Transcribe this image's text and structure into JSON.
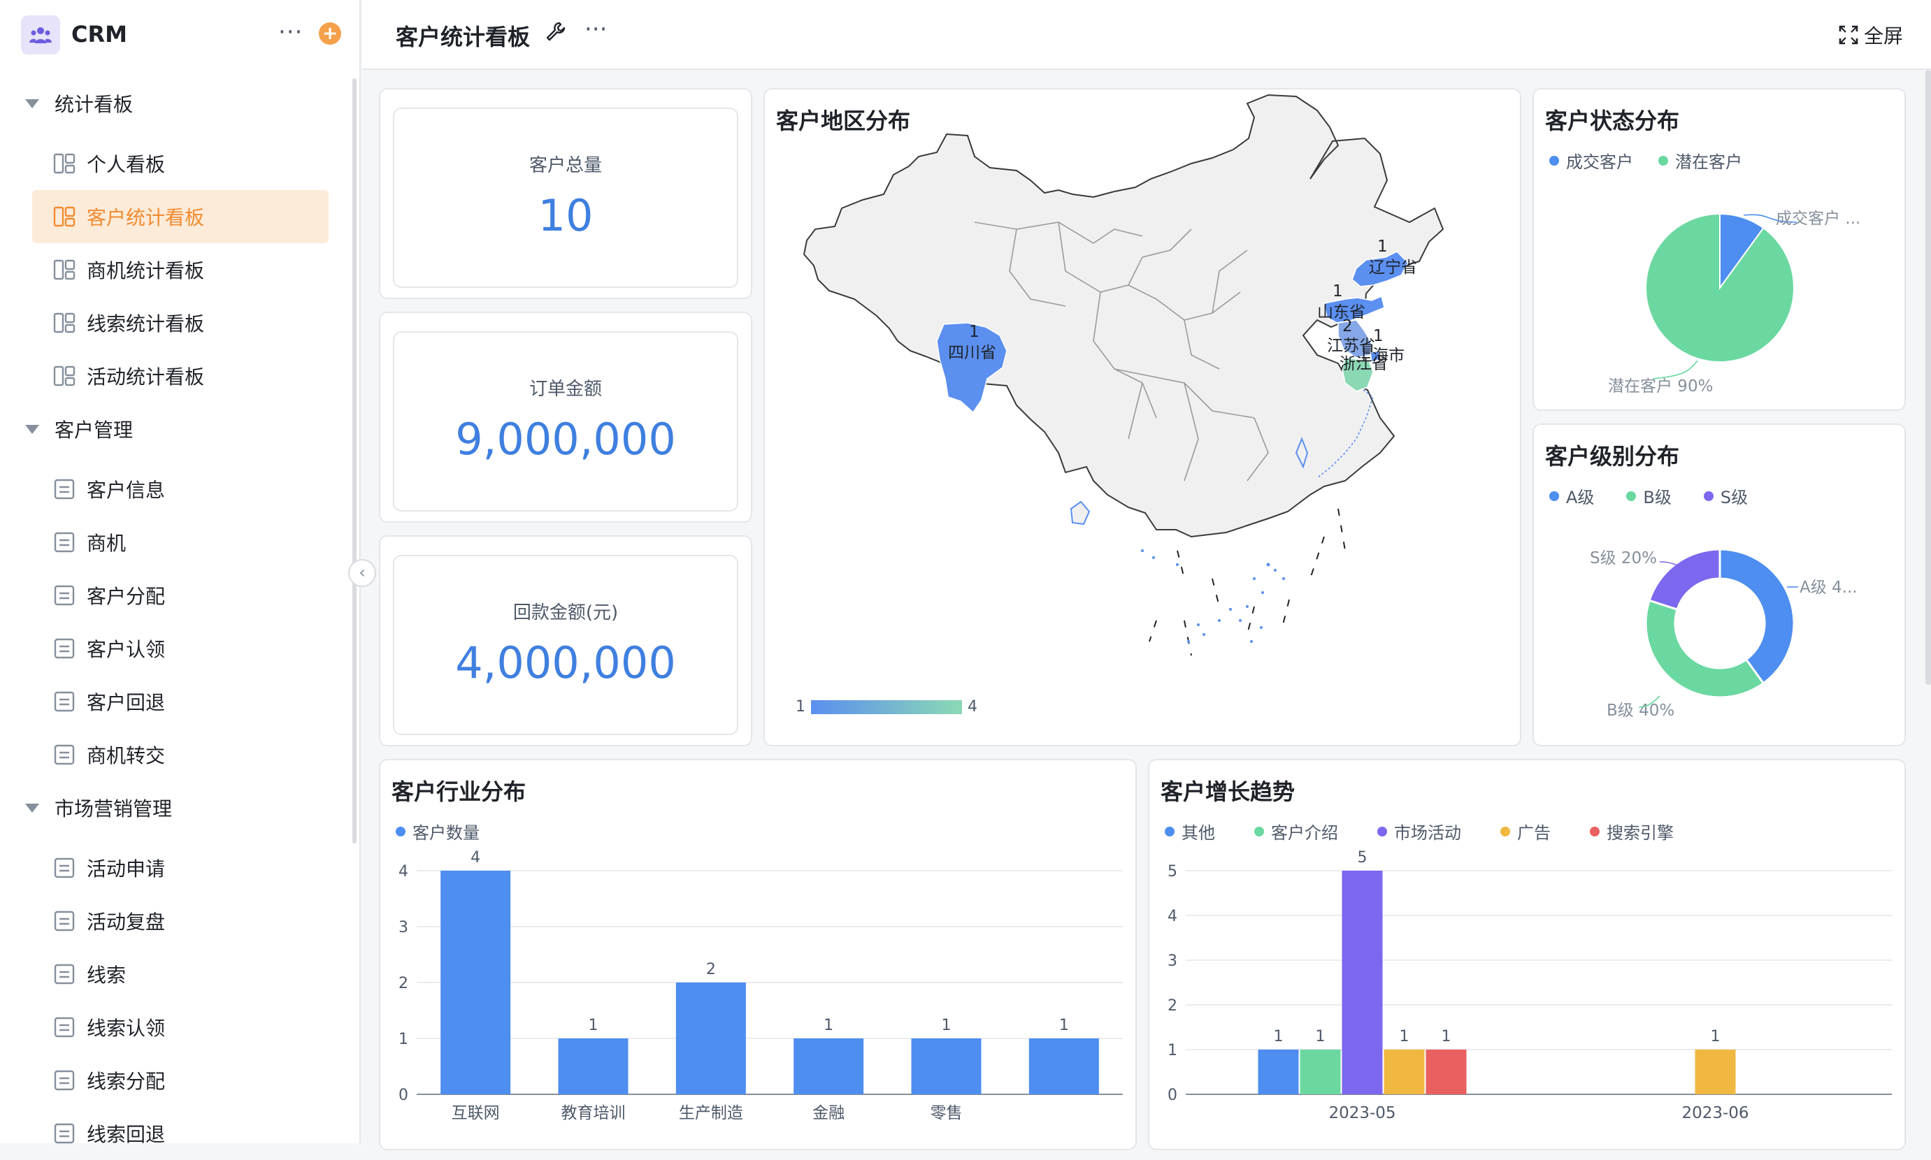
{
  "app": {
    "name": "CRM"
  },
  "header": {
    "title": "客户统计看板",
    "fullscreen_label": "全屏"
  },
  "sidebar": {
    "groups": [
      {
        "label": "统计看板",
        "items": [
          "个人看板",
          "客户统计看板",
          "商机统计看板",
          "线索统计看板",
          "活动统计看板"
        ]
      },
      {
        "label": "客户管理",
        "items": [
          "客户信息",
          "商机",
          "客户分配",
          "客户认领",
          "客户回退",
          "商机转交"
        ]
      },
      {
        "label": "市场营销管理",
        "items": [
          "活动申请",
          "活动复盘",
          "线索",
          "线索认领",
          "线索分配",
          "线索回退"
        ]
      }
    ],
    "active_item": "客户统计看板"
  },
  "kpis": [
    {
      "label": "客户总量",
      "value": "10"
    },
    {
      "label": "订单金额",
      "value": "9,000,000"
    },
    {
      "label": "回款金额(元)",
      "value": "4,000,000"
    }
  ],
  "map_card": {
    "title": "客户地区分布",
    "scale_min": "1",
    "scale_max": "4",
    "regions": [
      {
        "name": "辽宁省",
        "value": "1"
      },
      {
        "name": "山东省",
        "value": "1"
      },
      {
        "name": "四川省",
        "value": "1"
      },
      {
        "name": "江苏省",
        "value": "2"
      },
      {
        "name": "上海市",
        "value": "1"
      },
      {
        "name": "浙江省",
        "value": ""
      }
    ],
    "colors": {
      "low": "#5b8ff0",
      "high": "#8bd9b4",
      "base": "#f0f0f0"
    }
  },
  "status_card": {
    "title": "客户状态分布",
    "chart_data": {
      "type": "pie",
      "series": [
        {
          "name": "成交客户",
          "value": 10,
          "color": "#4d8ef0"
        },
        {
          "name": "潜在客户",
          "value": 90,
          "color": "#6ad8a0"
        }
      ],
      "labels": [
        "成交客户 ...",
        "潜在客户 90%"
      ],
      "legend": "top-left"
    }
  },
  "level_card": {
    "title": "客户级别分布",
    "chart_data": {
      "type": "pie",
      "donut": true,
      "series": [
        {
          "name": "A级",
          "value": 40,
          "color": "#4d8ef0"
        },
        {
          "name": "B级",
          "value": 40,
          "color": "#6ad8a0"
        },
        {
          "name": "S级",
          "value": 20,
          "color": "#7b68ee"
        }
      ],
      "labels": [
        "A级 4...",
        "B级 40%",
        "S级 20%"
      ],
      "legend": "top-left"
    }
  },
  "industry_card": {
    "title": "客户行业分布",
    "chart_data": {
      "type": "bar",
      "series": [
        {
          "name": "客户数量",
          "color": "#4d8ef0"
        }
      ],
      "categories": [
        "互联网",
        "教育培训",
        "生产制造",
        "金融",
        "零售",
        ""
      ],
      "values": [
        4,
        1,
        2,
        1,
        1,
        1
      ],
      "ylim": [
        0,
        4
      ],
      "yticks": [
        "0",
        "1",
        "2",
        "3",
        "4"
      ],
      "legend": "top-left"
    }
  },
  "growth_card": {
    "title": "客户增长趋势",
    "chart_data": {
      "type": "bar",
      "categories": [
        "2023-05",
        "2023-06"
      ],
      "series": [
        {
          "name": "其他",
          "color": "#4d8ef0",
          "values": [
            1,
            0
          ]
        },
        {
          "name": "客户介绍",
          "color": "#6ad8a0",
          "values": [
            1,
            0
          ]
        },
        {
          "name": "市场活动",
          "color": "#7b68ee",
          "values": [
            5,
            0
          ]
        },
        {
          "name": "广告",
          "color": "#f0b840",
          "values": [
            1,
            1
          ]
        },
        {
          "name": "搜索引擎",
          "color": "#ea5f5f",
          "values": [
            1,
            0
          ]
        }
      ],
      "ylim": [
        0,
        5
      ],
      "yticks": [
        "0",
        "1",
        "2",
        "3",
        "4",
        "5"
      ],
      "legend": "top-left"
    }
  }
}
